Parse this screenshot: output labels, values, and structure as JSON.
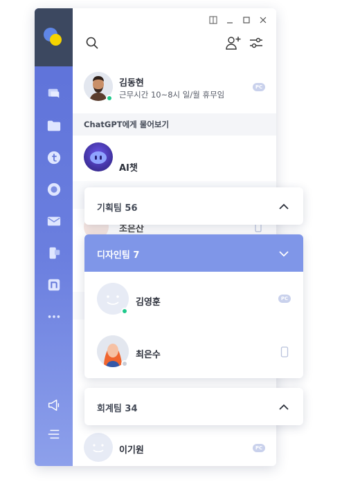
{
  "colors": {
    "sidebar_gradient_top": "#5c70d8",
    "sidebar_gradient_bottom": "#8da0eb",
    "sidebar_header": "#3c4860",
    "accent": "#7f96e8",
    "online": "#1ec98b",
    "offline": "#c8ccd6"
  },
  "sidebar": {
    "items": [
      {
        "icon": "chat-icon"
      },
      {
        "icon": "folder-icon"
      },
      {
        "icon": "t-app-icon"
      },
      {
        "icon": "record-icon"
      },
      {
        "icon": "mail-icon"
      },
      {
        "icon": "phone-copy-icon"
      },
      {
        "icon": "n-app-icon"
      },
      {
        "icon": "more-icon"
      },
      {
        "icon": "megaphone-icon"
      },
      {
        "icon": "menu-icon"
      }
    ]
  },
  "window_controls": [
    "split-view-icon",
    "minimize-icon",
    "maximize-icon",
    "close-icon"
  ],
  "toolbar": {
    "search": "search-icon",
    "add_user": "add-user-icon",
    "filter": "filter-icon"
  },
  "my_profile": {
    "name": "김동현",
    "status": "근무시간 10~8시 일/월 휴무임",
    "device": "PC"
  },
  "ai_section": {
    "header": "ChatGPT에게 물어보기",
    "item": "AI챗"
  },
  "behind": {
    "partial_name": "조은산"
  },
  "groups": [
    {
      "title": "기획팀 56",
      "expanded": false
    },
    {
      "title": "디자인팀 7",
      "expanded": true,
      "members": [
        {
          "name": "김영훈",
          "device": "PC",
          "online": true
        },
        {
          "name": "최은수",
          "device": "mobile",
          "online": false
        }
      ]
    },
    {
      "title": "회계팀 34",
      "expanded": false
    }
  ],
  "bottom_contact": {
    "name": "이기원",
    "device": "PC"
  }
}
